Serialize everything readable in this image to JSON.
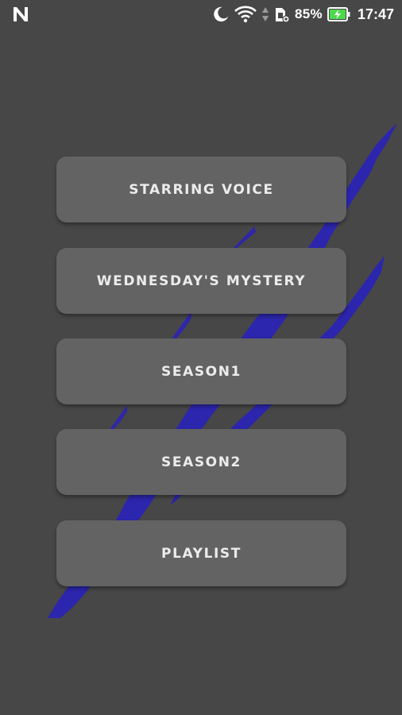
{
  "status_bar": {
    "battery_percent": "85%",
    "time": "17:47",
    "icons": [
      "notification-n-icon",
      "moon-icon",
      "wifi-icon",
      "data-arrows-icon",
      "sim-card-icon",
      "battery-charging-icon"
    ],
    "battery_level": 0.85,
    "battery_color": "#4cd94c"
  },
  "colors": {
    "background": "#474747",
    "button": "#636363",
    "button_text": "#ececec",
    "accent_scratch": "#3a2fc0"
  },
  "menu": {
    "items": [
      {
        "label": "STARRING VOICE"
      },
      {
        "label": "WEDNESDAY'S MYSTERY"
      },
      {
        "label": "SEASON1"
      },
      {
        "label": "SEASON2"
      },
      {
        "label": "PLAYLIST"
      }
    ]
  }
}
